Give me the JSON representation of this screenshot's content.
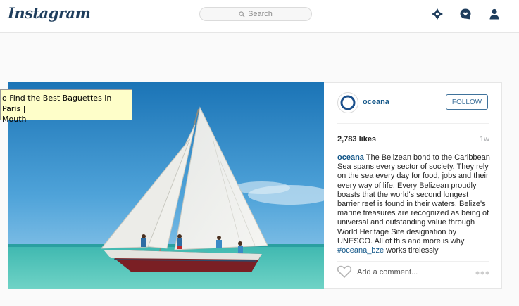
{
  "header": {
    "logo": "Instagram",
    "search_placeholder": "Search",
    "icons": [
      "compass-icon",
      "activity-heart-icon",
      "profile-icon"
    ]
  },
  "tooltip": {
    "line1": "o Find the Best Baguettes in Paris |",
    "line2": "Mouth"
  },
  "post": {
    "username": "oceana",
    "follow_label": "FOLLOW",
    "likes": "2,783 likes",
    "age": "1w",
    "caption_user": "oceana",
    "caption_text": " The Belizean bond to the Caribbean Sea spans every sector of society. They rely on the sea every day for food, jobs and their every way of life. Every Belizean proudly boasts that the world's second longest barrier reef is found in their waters. Belize's marine treasures are recognized as being of universal and outstanding value through World Heritage Site designation by UNESCO. All of this and more is why ",
    "caption_hashtag": "#oceana_bze",
    "caption_tail": " works tirelessly",
    "comment_placeholder": "Add a comment..."
  },
  "colors": {
    "link": "#125688",
    "button": "#3f729b",
    "logo": "#1e3d5c"
  }
}
